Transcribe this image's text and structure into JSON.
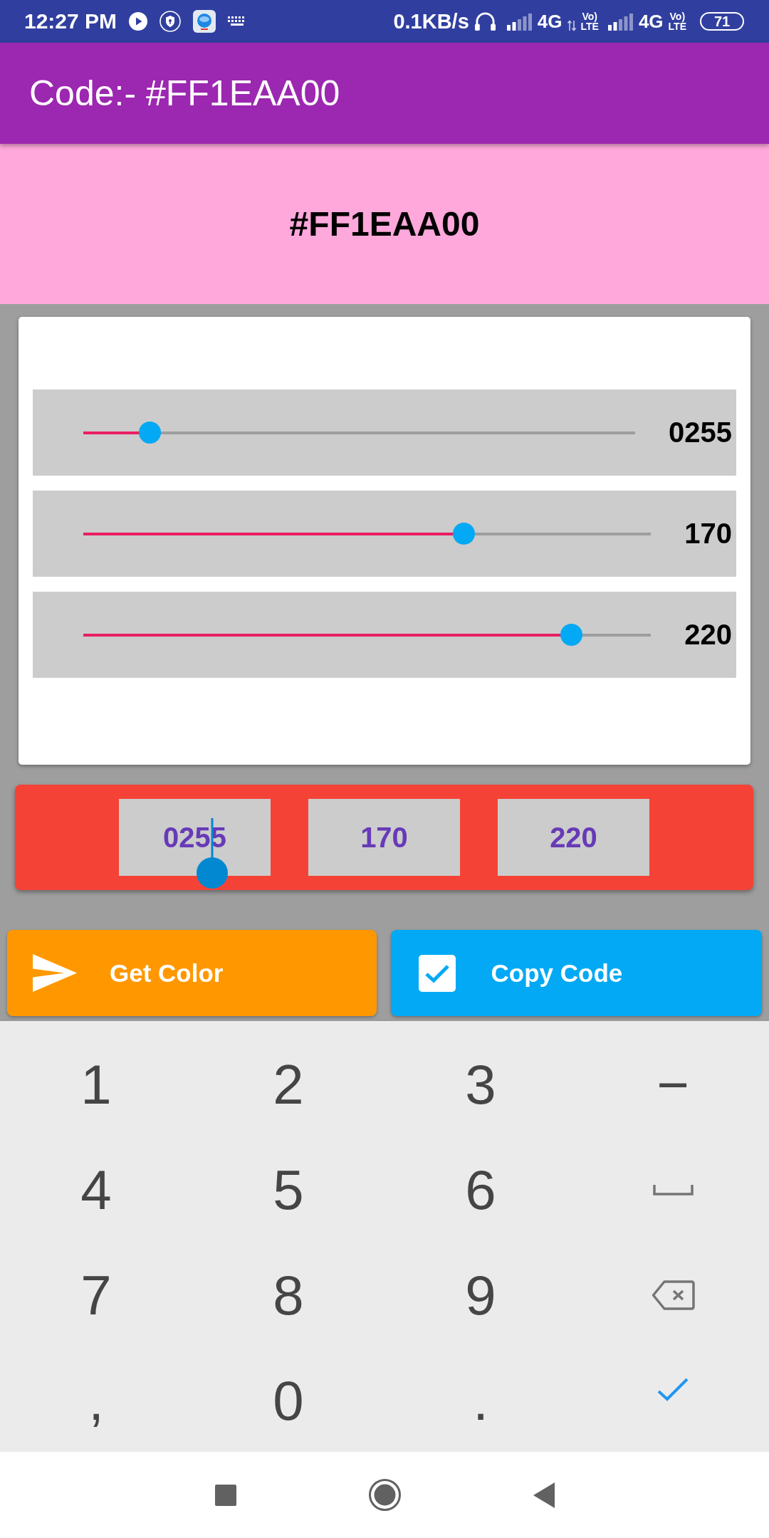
{
  "status_bar": {
    "time": "12:27 PM",
    "net_speed": "0.1KB/s",
    "sims": [
      {
        "network": "4G",
        "data_active": true,
        "volte": [
          "Vo)",
          "LTE"
        ]
      },
      {
        "network": "4G",
        "data_active": false,
        "volte": [
          "Vo)",
          "LTE"
        ]
      }
    ],
    "battery": "71"
  },
  "app_bar": {
    "title": "Code:- #FF1EAA00"
  },
  "color_preview": {
    "code": "#FF1EAA00"
  },
  "sliders": [
    {
      "level": 0.12,
      "value": "0255"
    },
    {
      "level": 0.67,
      "value": "170"
    },
    {
      "level": 0.86,
      "value": "220"
    }
  ],
  "fields": [
    {
      "value": "0255",
      "focused": true
    },
    {
      "value": "170",
      "focused": false
    },
    {
      "value": "220",
      "focused": false
    }
  ],
  "buttons": [
    {
      "kind": "send",
      "label": "Get Color"
    },
    {
      "kind": "copy",
      "label": "Copy Code"
    }
  ],
  "keyboard": {
    "rows": [
      [
        {
          "kind": "char",
          "label": "1"
        },
        {
          "kind": "char",
          "label": "2"
        },
        {
          "kind": "char",
          "label": "3"
        },
        {
          "kind": "char",
          "label": "−"
        }
      ],
      [
        {
          "kind": "char",
          "label": "4"
        },
        {
          "kind": "char",
          "label": "5"
        },
        {
          "kind": "char",
          "label": "6"
        },
        {
          "kind": "space"
        }
      ],
      [
        {
          "kind": "char",
          "label": "7"
        },
        {
          "kind": "char",
          "label": "8"
        },
        {
          "kind": "char",
          "label": "9"
        },
        {
          "kind": "backspace"
        }
      ],
      [
        {
          "kind": "char",
          "label": ","
        },
        {
          "kind": "char",
          "label": "0"
        },
        {
          "kind": "char",
          "label": "."
        },
        {
          "kind": "enter"
        }
      ]
    ]
  }
}
